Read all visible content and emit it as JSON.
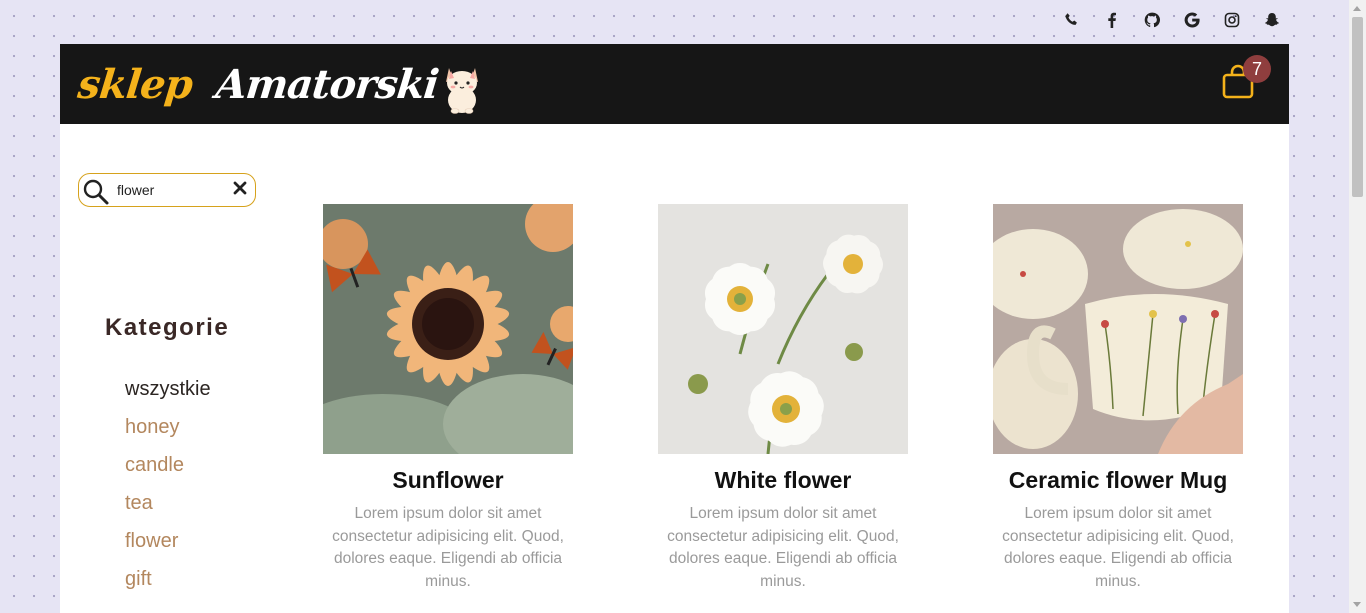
{
  "logo": {
    "part1": "sklep",
    "part2": "Amatorski",
    "mascot_icon": "cat-mascot-icon"
  },
  "social_icons": [
    "phone-icon",
    "facebook-icon",
    "github-icon",
    "google-icon",
    "instagram-icon",
    "snapchat-icon"
  ],
  "cart": {
    "count": "7",
    "icon": "shopping-bag-icon"
  },
  "search": {
    "value": "flower",
    "icon": "search-icon",
    "clear_icon": "close-icon"
  },
  "sidebar": {
    "title": "Kategorie",
    "items": [
      {
        "label": "wszystkie",
        "active": true
      },
      {
        "label": "honey"
      },
      {
        "label": "candle"
      },
      {
        "label": "tea"
      },
      {
        "label": "flower"
      },
      {
        "label": "gift"
      }
    ]
  },
  "products": [
    {
      "name": "Sunflower",
      "description": "Lorem ipsum dolor sit amet consectetur adipisicing elit. Quod, dolores eaque. Eligendi ab officia minus."
    },
    {
      "name": "White flower",
      "description": "Lorem ipsum dolor sit amet consectetur adipisicing elit. Quod, dolores eaque. Eligendi ab officia minus."
    },
    {
      "name": "Ceramic flower Mug",
      "description": "Lorem ipsum dolor sit amet consectetur adipisicing elit. Quod, dolores eaque. Eligendi ab officia minus."
    }
  ],
  "colors": {
    "accent": "#f4b21b",
    "header_bg": "#161616",
    "category_link": "#b3875e",
    "badge": "#8f3e3e",
    "page_bg": "#e6e4f4"
  }
}
